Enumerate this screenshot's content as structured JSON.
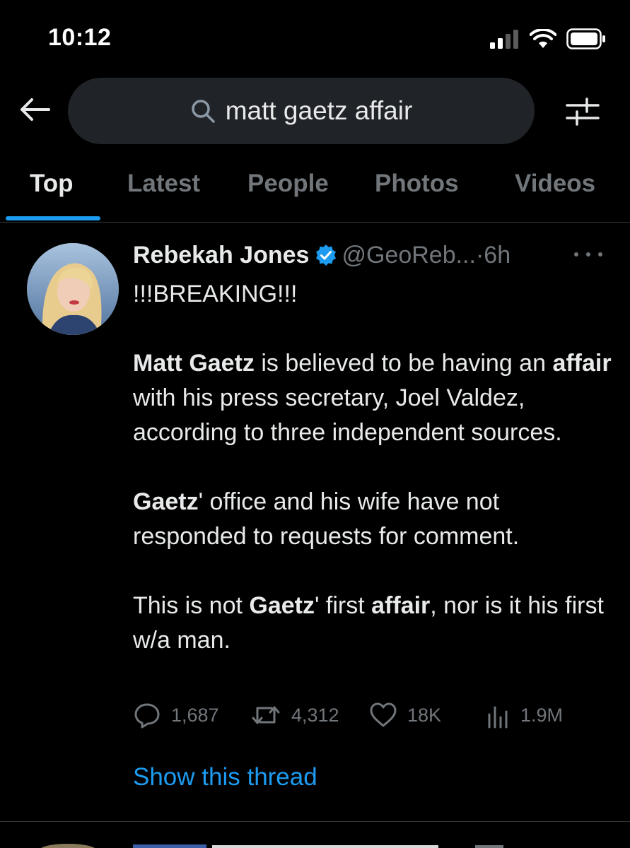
{
  "status_bar": {
    "time": "10:12"
  },
  "search": {
    "query": "matt gaetz affair"
  },
  "tabs": [
    {
      "label": "Top",
      "active": true
    },
    {
      "label": "Latest",
      "active": false
    },
    {
      "label": "People",
      "active": false
    },
    {
      "label": "Photos",
      "active": false
    },
    {
      "label": "Videos",
      "active": false
    }
  ],
  "tweet": {
    "author_name": "Rebekah Jones",
    "handle": "@GeoReb...",
    "separator": " · ",
    "age": "6h",
    "headline": "!!!BREAKING!!!",
    "p1_bold1": "Matt Gaetz",
    "p1_text1": " is believed to be having an ",
    "p1_bold2": "affair",
    "p1_text2": " with his press secretary, Joel Valdez, according to three independent sources.",
    "p2_bold1": "Gaetz",
    "p2_text1": "' office and his wife have not responded to requests for comment.",
    "p3_text1": "This is not ",
    "p3_bold1": "Gaetz",
    "p3_text2": "' first ",
    "p3_bold2": "affair",
    "p3_text3": ", nor is it his first w/a man.",
    "stats": {
      "replies": "1,687",
      "retweets": "4,312",
      "likes": "18K",
      "views": "1.9M"
    },
    "show_thread": "Show this thread"
  },
  "colors": {
    "background": "#000000",
    "accent": "#1d9bf0",
    "muted": "#71767b",
    "text": "#e7e9ea",
    "search_bg": "#202327"
  },
  "icons": [
    "back-arrow-icon",
    "search-icon",
    "filter-sliders-icon",
    "verified-badge-icon",
    "more-icon",
    "reply-icon",
    "retweet-icon",
    "like-icon",
    "views-icon"
  ]
}
